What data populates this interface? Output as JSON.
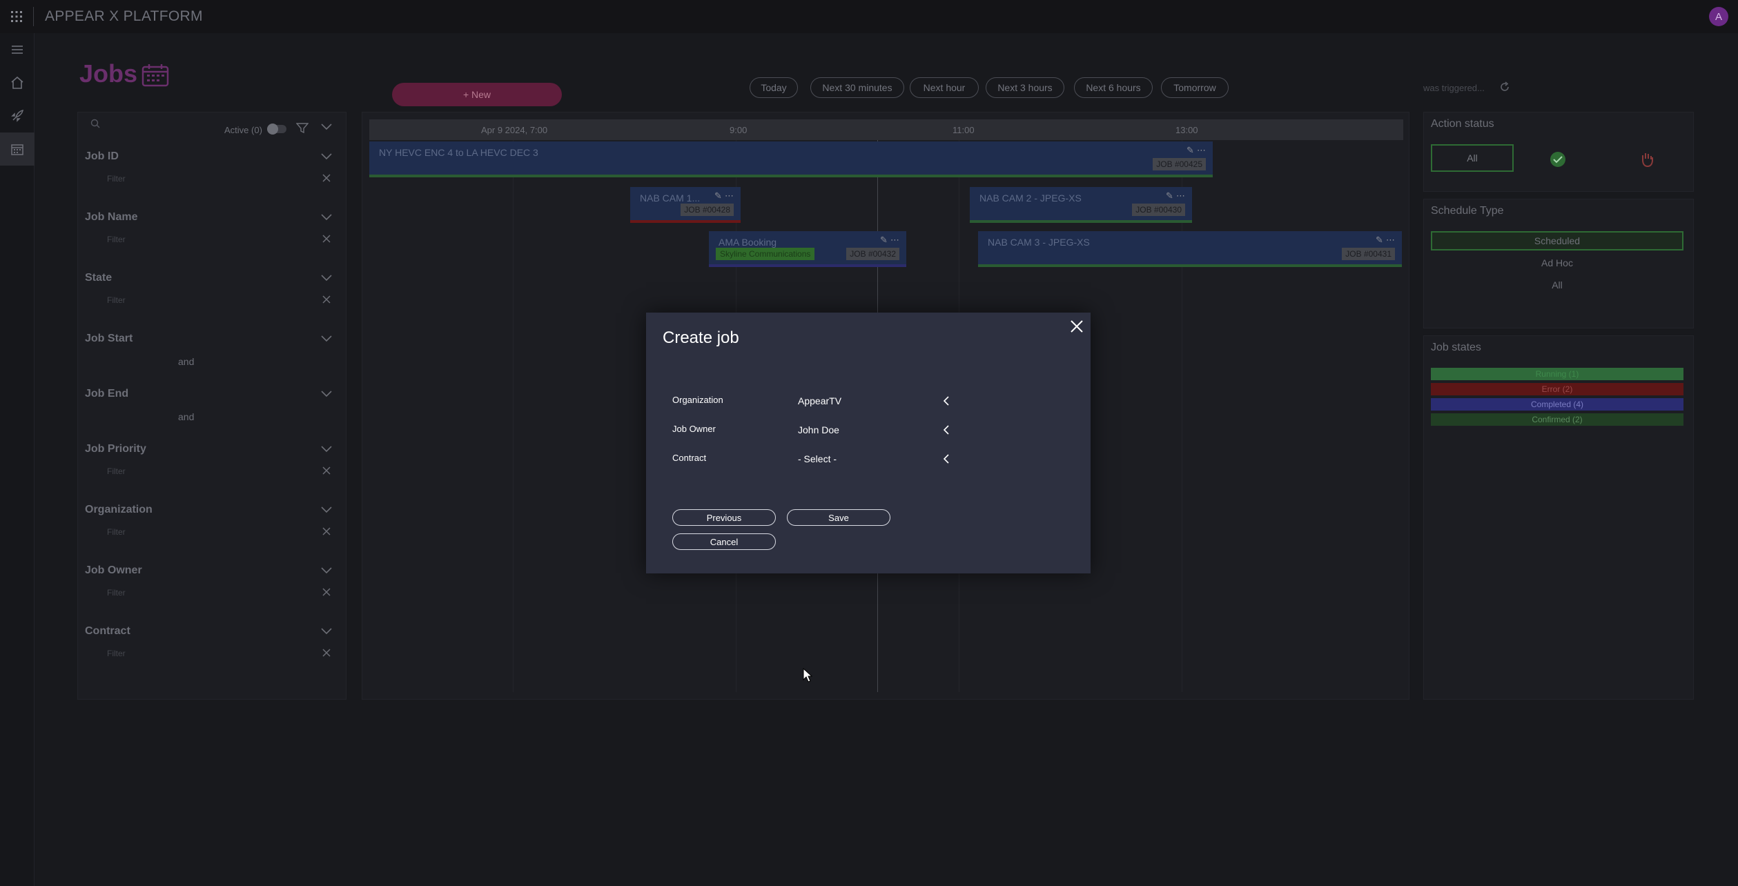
{
  "app": {
    "title": "APPEAR X PLATFORM",
    "avatar_letter": "A"
  },
  "nav": {
    "icons": [
      "menu-icon",
      "home-icon",
      "rocket-icon",
      "calendar-icon"
    ]
  },
  "page": {
    "title": "Jobs",
    "new_button": "+ New",
    "triggered_text": "was triggered..."
  },
  "time_ranges": [
    "Today",
    "Next 30 minutes",
    "Next hour",
    "Next 3 hours",
    "Next 6 hours",
    "Tomorrow"
  ],
  "filters": {
    "active_label": "Active (0)",
    "placeholder": "Filter",
    "sections": [
      {
        "label": "Job ID",
        "kind": "filter"
      },
      {
        "label": "Job Name",
        "kind": "filter"
      },
      {
        "label": "State",
        "kind": "filter"
      },
      {
        "label": "Job Start",
        "kind": "range",
        "joiner": "and"
      },
      {
        "label": "Job End",
        "kind": "range",
        "joiner": "and"
      },
      {
        "label": "Job Priority",
        "kind": "filter"
      },
      {
        "label": "Organization",
        "kind": "filter"
      },
      {
        "label": "Job Owner",
        "kind": "filter"
      },
      {
        "label": "Contract",
        "kind": "filter"
      }
    ]
  },
  "timeline": {
    "ticks": [
      "Apr 9 2024, 7:00",
      "9:00",
      "11:00",
      "13:00"
    ],
    "jobs": [
      {
        "name": "NY HEVC ENC 4 to LA HEVC DEC 3",
        "id": "JOB #00425"
      },
      {
        "name": "NAB CAM 1...",
        "id": "JOB #00428"
      },
      {
        "name": "NAB CAM 2 - JPEG-XS",
        "id": "JOB #00430"
      },
      {
        "name": "AMA Booking",
        "id": "JOB #00432",
        "org": "Skyline Communications"
      },
      {
        "name": "NAB CAM 3 - JPEG-XS",
        "id": "JOB #00431"
      }
    ]
  },
  "action_status": {
    "title": "Action status",
    "all_label": "All"
  },
  "schedule_type": {
    "title": "Schedule Type",
    "options": [
      "Scheduled",
      "Ad Hoc",
      "All"
    ],
    "selected": "Scheduled"
  },
  "job_states": {
    "title": "Job states",
    "items": [
      {
        "label": "Running (1)",
        "bg": "#2f6a3a",
        "fg": "#3f8a4c"
      },
      {
        "label": "Error (2)",
        "bg": "#5c1616",
        "fg": "#9a4a4a"
      },
      {
        "label": "Completed (4)",
        "bg": "#2a2c72",
        "fg": "#7a7cc2"
      },
      {
        "label": "Confirmed (2)",
        "bg": "#213f24",
        "fg": "#5b8a5e"
      }
    ]
  },
  "dialog": {
    "title": "Create job",
    "fields": [
      {
        "label": "Organization",
        "value": "AppearTV"
      },
      {
        "label": "Job Owner",
        "value": "John Doe"
      },
      {
        "label": "Contract",
        "value": "- Select -"
      }
    ],
    "buttons": {
      "previous": "Previous",
      "save": "Save",
      "cancel": "Cancel"
    }
  },
  "colors": {
    "accent": "#6a2f6c",
    "dialog_bg": "#2d3040",
    "success": "#2e6b34"
  }
}
